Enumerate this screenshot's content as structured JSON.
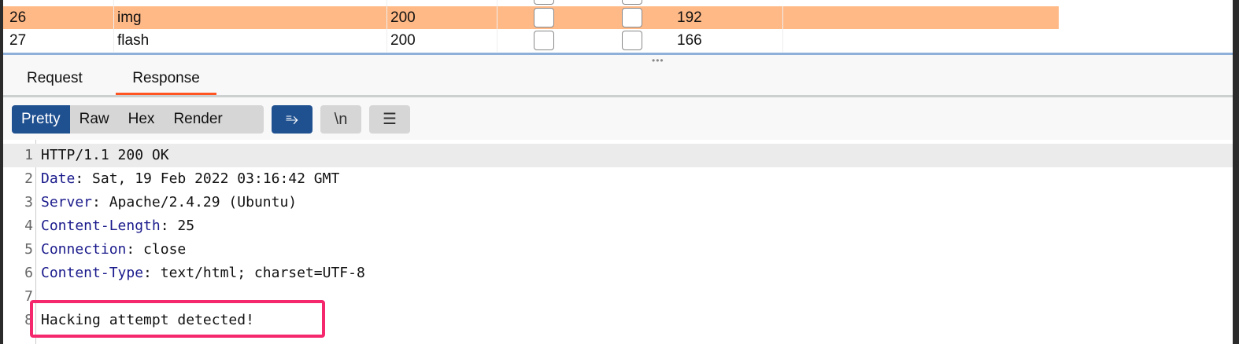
{
  "table": {
    "rows": [
      {
        "id": "26",
        "type": "img",
        "status": "200",
        "length": "192",
        "selected": true
      },
      {
        "id": "27",
        "type": "flash",
        "status": "200",
        "length": "166",
        "selected": false
      }
    ],
    "highlight_color": "#ffb987"
  },
  "tabs": [
    {
      "label": "Request"
    },
    {
      "label": "Response",
      "active": true
    }
  ],
  "viewer": {
    "modes": [
      "Pretty",
      "Raw",
      "Hex",
      "Render"
    ],
    "active_mode": "Pretty",
    "wrap_icon": "wrap-lines-icon",
    "newline_label": "\\n",
    "menu_icon": "hamburger-menu-icon"
  },
  "response": {
    "lines": [
      {
        "n": "1",
        "key": "",
        "value": "HTTP/1.1 200 OK"
      },
      {
        "n": "2",
        "key": "Date",
        "value": " Sat, 19 Feb 2022 03:16:42 GMT"
      },
      {
        "n": "3",
        "key": "Server",
        "value": " Apache/2.4.29 (Ubuntu)"
      },
      {
        "n": "4",
        "key": "Content-Length",
        "value": " 25"
      },
      {
        "n": "5",
        "key": "Connection",
        "value": " close"
      },
      {
        "n": "6",
        "key": "Content-Type",
        "value": " text/html; charset=UTF-8"
      },
      {
        "n": "7",
        "key": "",
        "value": ""
      },
      {
        "n": "8",
        "key": "",
        "value": "Hacking attempt detected!"
      }
    ],
    "annotation_color": "#f5286e"
  }
}
